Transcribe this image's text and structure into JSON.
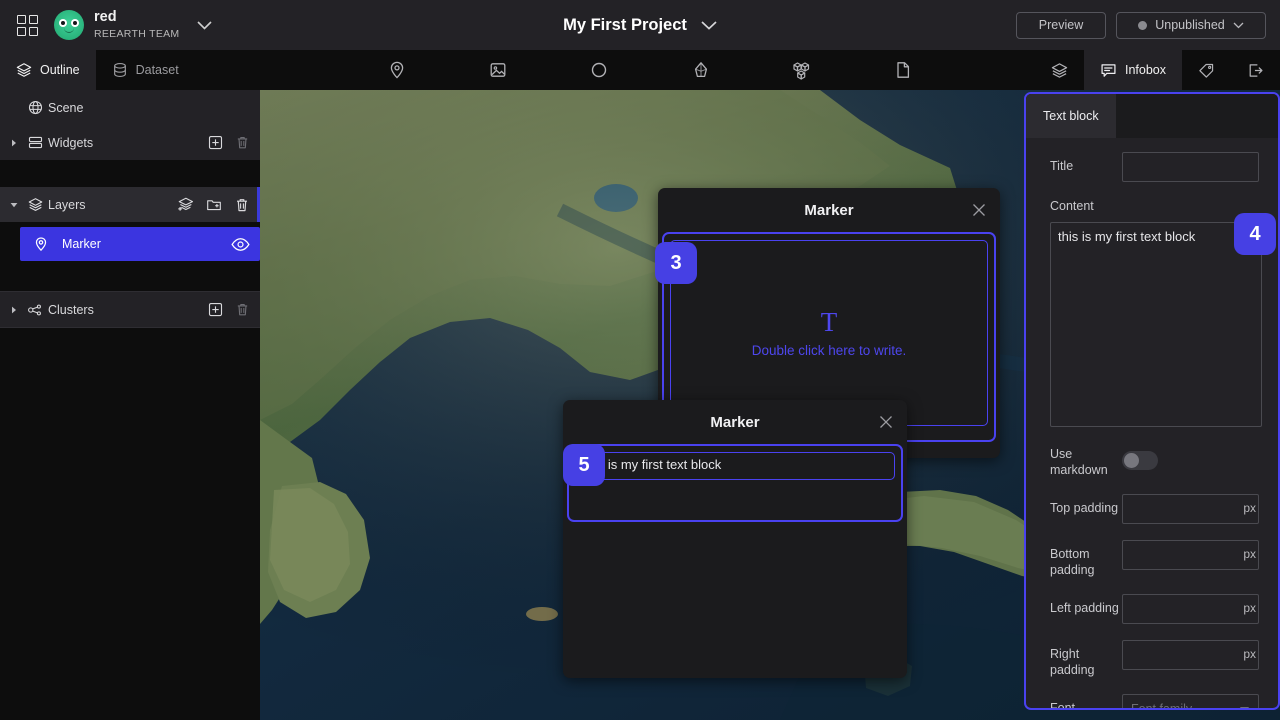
{
  "topbar": {
    "dashboard_icon": "grid-icon",
    "workspace_name": "red",
    "workspace_team": "REEARTH TEAM",
    "workspace_chevron": "chevron-down-icon",
    "project_title": "My First Project",
    "project_chevron": "chevron-down-icon",
    "preview_label": "Preview",
    "publish_status": "Unpublished",
    "publish_chevron": "chevron-down-icon",
    "accent_color": "#4640e4",
    "bar_color": "#232226"
  },
  "toolbar": {
    "left_tabs": [
      {
        "label": "Outline",
        "icon": "layers-icon",
        "active": true
      },
      {
        "label": "Dataset",
        "icon": "database-icon",
        "active": false
      }
    ],
    "center_icons": [
      "map-pin-icon",
      "image-icon",
      "circle-icon",
      "polygon-3d-icon",
      "blocks-icon",
      "file-icon"
    ],
    "right_tabs": [
      {
        "label": "",
        "icon": "layers-icon",
        "active": false
      },
      {
        "label": "Infobox",
        "icon": "infobox-icon",
        "active": true
      },
      {
        "label": "",
        "icon": "tag-icon",
        "active": false
      },
      {
        "label": "",
        "icon": "export-icon",
        "active": false
      }
    ]
  },
  "sidebar": {
    "rows": [
      {
        "label": "Scene",
        "icon": "globe-icon",
        "arrow": false,
        "actions": []
      },
      {
        "label": "Widgets",
        "icon": "widgets-icon",
        "arrow": true,
        "actions": [
          "add-icon",
          "trash-icon"
        ]
      }
    ],
    "layers_header": {
      "label": "Layers",
      "icon": "layers-icon",
      "actions": [
        "add-layer-icon",
        "new-folder-icon",
        "trash-icon"
      ]
    },
    "layer_item": {
      "label": "Marker",
      "icon": "map-pin-icon",
      "visibility_icon": "eye-icon",
      "selected": true
    },
    "clusters_row": {
      "label": "Clusters",
      "icon": "clusters-icon",
      "arrow": true,
      "actions": [
        "add-icon",
        "trash-icon"
      ]
    },
    "selected_color": "#3b35e0"
  },
  "map": {
    "region": "East Asia satellite imagery",
    "attribution": ""
  },
  "infobox_back": {
    "title": "Marker",
    "close_icon": "close-icon",
    "placeholder_glyph": "T",
    "placeholder_text": "Double click here to write.",
    "badge": "3"
  },
  "infobox_front": {
    "title": "Marker",
    "close_icon": "close-icon",
    "text": "this is my first text block",
    "badge": "5"
  },
  "right_panel": {
    "tab_label": "Text block",
    "badge": "4",
    "fields": {
      "title_label": "Title",
      "title_value": "",
      "title_placeholder": "",
      "content_label": "Content",
      "content_value": "this is my first text block",
      "markdown_label": "Use markdown",
      "markdown_on": false,
      "top_padding_label": "Top padding",
      "top_padding_value": "",
      "bottom_padding_label": "Bottom padding",
      "bottom_padding_value": "",
      "left_padding_label": "Left padding",
      "left_padding_value": "",
      "right_padding_label": "Right padding",
      "right_padding_value": "",
      "unit": "px",
      "font_label": "Font",
      "font_value": "Font family"
    }
  }
}
